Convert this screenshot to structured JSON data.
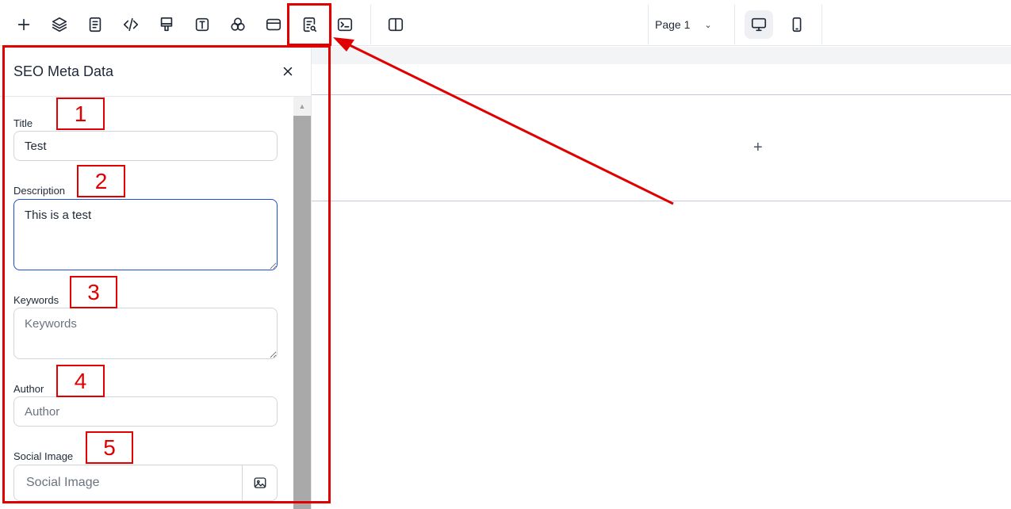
{
  "toolbar": {
    "tools": [
      {
        "icon": "plus-icon"
      },
      {
        "icon": "layers-icon"
      },
      {
        "icon": "page-icon"
      },
      {
        "icon": "code-icon"
      },
      {
        "icon": "paint-brush-icon"
      },
      {
        "icon": "text-icon"
      },
      {
        "icon": "color-circles-icon"
      },
      {
        "icon": "layout-icon"
      },
      {
        "icon": "seo-search-icon"
      },
      {
        "icon": "terminal-icon"
      },
      {
        "icon": "split-view-icon"
      }
    ],
    "page_select": {
      "value": "Page 1"
    },
    "devices": [
      {
        "icon": "desktop-icon",
        "active": true
      },
      {
        "icon": "mobile-icon",
        "active": false
      }
    ]
  },
  "panel": {
    "title": "SEO Meta Data",
    "fields": {
      "title": {
        "label": "Title",
        "value": "Test",
        "placeholder": ""
      },
      "description": {
        "label": "Description",
        "value": "This is a test",
        "placeholder": ""
      },
      "keywords": {
        "label": "Keywords",
        "value": "",
        "placeholder": "Keywords"
      },
      "author": {
        "label": "Author",
        "value": "",
        "placeholder": "Author"
      },
      "social_image": {
        "label": "Social Image",
        "value": "",
        "placeholder": "Social Image"
      }
    }
  },
  "canvas": {
    "add_symbol": "+"
  },
  "annotations": {
    "color": "#e00000",
    "numbers": [
      "1",
      "2",
      "3",
      "4",
      "5"
    ]
  },
  "colors": {
    "focus_border": "#1d4ed8",
    "border": "#d1d5db",
    "text": "#1f2937"
  }
}
